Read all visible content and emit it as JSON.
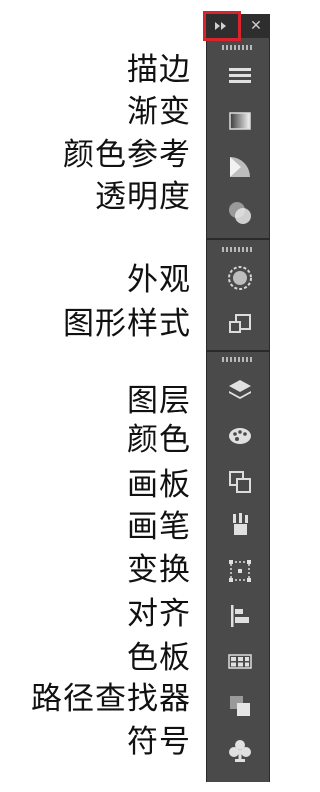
{
  "panel": {
    "items": [
      {
        "label": "描边",
        "icon": "stroke-icon"
      },
      {
        "label": "渐变",
        "icon": "gradient-icon"
      },
      {
        "label": "颜色参考",
        "icon": "color-guide-icon"
      },
      {
        "label": "透明度",
        "icon": "transparency-icon"
      },
      {
        "label": "外观",
        "icon": "appearance-icon"
      },
      {
        "label": "图形样式",
        "icon": "graphic-styles-icon"
      },
      {
        "label": "图层",
        "icon": "layers-icon"
      },
      {
        "label": "颜色",
        "icon": "color-icon"
      },
      {
        "label": "画板",
        "icon": "artboards-icon"
      },
      {
        "label": "画笔",
        "icon": "brushes-icon"
      },
      {
        "label": "变换",
        "icon": "transform-icon"
      },
      {
        "label": "对齐",
        "icon": "align-icon"
      },
      {
        "label": "色板",
        "icon": "swatches-icon"
      },
      {
        "label": "路径查找器",
        "icon": "pathfinder-icon"
      },
      {
        "label": "符号",
        "icon": "symbols-icon"
      }
    ]
  },
  "highlight_color": "#d9232d"
}
